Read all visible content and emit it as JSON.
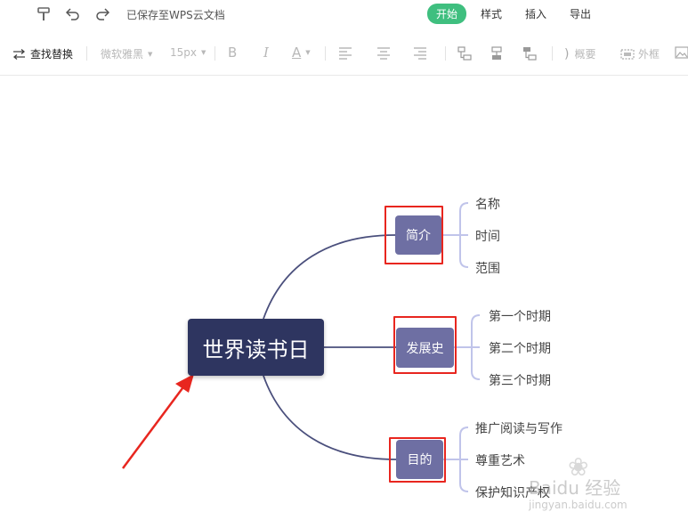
{
  "topbar": {
    "save_status": "已保存至WPS云文档",
    "tabs": [
      {
        "label": "开始",
        "active": true
      },
      {
        "label": "样式",
        "active": false
      },
      {
        "label": "插入",
        "active": false
      },
      {
        "label": "导出",
        "active": false
      }
    ]
  },
  "toolbar": {
    "find_replace": "查找替换",
    "font_family": "微软雅黑",
    "font_size": "15px",
    "bold": "B",
    "italic": "I",
    "font_color": "A",
    "summary": "概要",
    "outer_frame": "外框"
  },
  "mindmap": {
    "root": "世界读书日",
    "branches": [
      {
        "label": "简介",
        "children": [
          "名称",
          "时间",
          "范围"
        ]
      },
      {
        "label": "发展史",
        "children": [
          "第一个时期",
          "第二个时期",
          "第三个时期"
        ]
      },
      {
        "label": "目的",
        "children": [
          "推广阅读与写作",
          "尊重艺术",
          "保护知识产权"
        ]
      }
    ]
  },
  "watermark": {
    "brand": "Baidu 经验",
    "url": "jingyan.baidu.com"
  },
  "colors": {
    "accent": "#3fbf7f",
    "root_fill": "#2e3560",
    "branch_fill": "#6e6fa3",
    "link": "#4a4f7c",
    "leaf_link": "#c0c4ea",
    "highlight": "#e8261f"
  }
}
